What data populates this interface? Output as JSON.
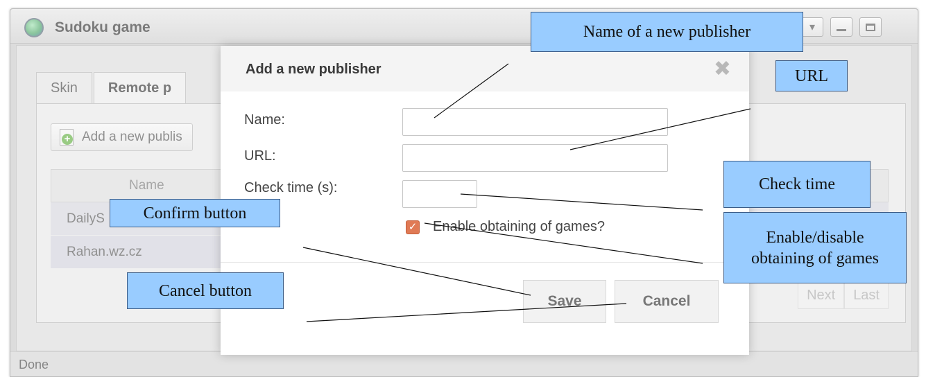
{
  "window": {
    "title": "Sudoku game",
    "tabs": [
      {
        "label": "Skin",
        "active": false
      },
      {
        "label": "Remote p",
        "active": true
      }
    ],
    "add_button_label": "Add a new publis",
    "grid": {
      "column_name": "Name",
      "rows": [
        {
          "name": "DailyS"
        },
        {
          "name": "Rahan.wz.cz"
        }
      ]
    },
    "pager": [
      "Next",
      "Last"
    ],
    "status": "Done"
  },
  "dialog": {
    "title": "Add a new publisher",
    "labels": {
      "name": "Name:",
      "url": "URL:",
      "check_time": "Check time (s):"
    },
    "fields": {
      "name_value": "",
      "url_value": "",
      "check_time_value": ""
    },
    "enable_checkbox": {
      "label": "Enable obtaining of games?",
      "checked": true
    },
    "buttons": {
      "save": "Save",
      "cancel": "Cancel"
    }
  },
  "callouts": {
    "name": "Name of a new publisher",
    "url": "URL",
    "check_time": "Check time",
    "enable_line1": "Enable/disable",
    "enable_line2": "obtaining of games",
    "confirm": "Confirm button",
    "cancel": "Cancel button"
  },
  "colors": {
    "callout_fill": "#99ccff",
    "checkbox_accent": "#e07a55"
  },
  "icons": [
    "app-globe-icon",
    "window-menu-icon",
    "minimize-icon",
    "maximize-icon",
    "add-document-icon",
    "close-icon",
    "checkmark-icon"
  ]
}
